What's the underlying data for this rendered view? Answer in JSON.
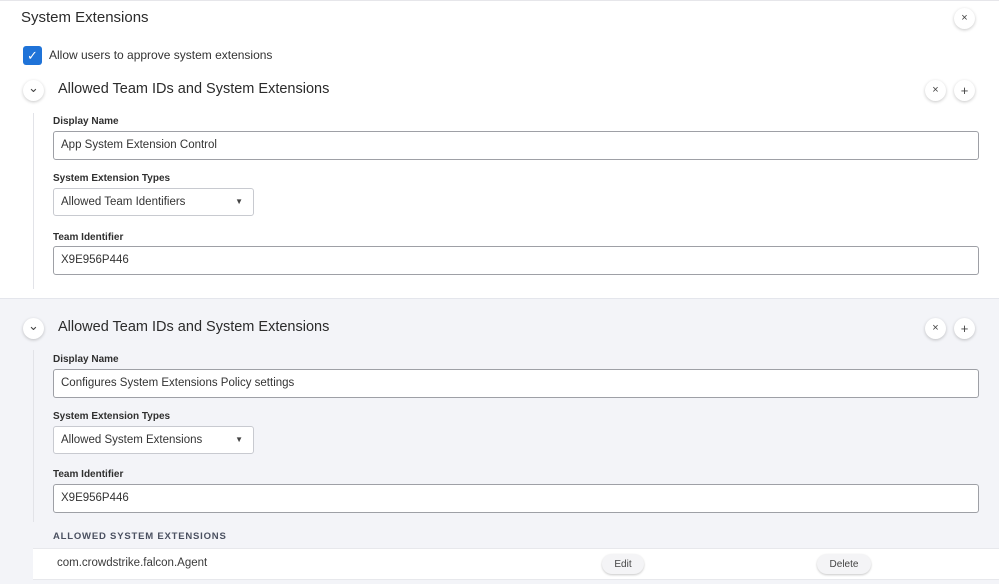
{
  "header": {
    "title": "System Extensions",
    "close_icon": "×"
  },
  "allow_approve": {
    "checked": true,
    "check_icon": "✓",
    "label": "Allow users to approve system extensions"
  },
  "groups": [
    {
      "heading": "Allowed Team IDs and System Extensions",
      "collapse_icon": "⌄",
      "remove_icon": "×",
      "add_icon": "+",
      "display_name_label": "Display Name",
      "display_name_value": "App System Extension Control",
      "types_label": "System Extension Types",
      "types_value": "Allowed Team Identifiers",
      "caret_icon": "▼",
      "team_id_label": "Team Identifier",
      "team_id_value": "X9E956P446"
    },
    {
      "heading": "Allowed Team IDs and System Extensions",
      "collapse_icon": "⌄",
      "remove_icon": "×",
      "add_icon": "+",
      "display_name_label": "Display Name",
      "display_name_value": "Configures System Extensions Policy settings",
      "types_label": "System Extension Types",
      "types_value": "Allowed System Extensions",
      "caret_icon": "▼",
      "team_id_label": "Team Identifier",
      "team_id_value": "X9E956P446",
      "extensions_header": "ALLOWED SYSTEM EXTENSIONS",
      "extensions": [
        {
          "name": "com.crowdstrike.falcon.Agent",
          "edit_label": "Edit",
          "delete_label": "Delete"
        }
      ]
    }
  ]
}
